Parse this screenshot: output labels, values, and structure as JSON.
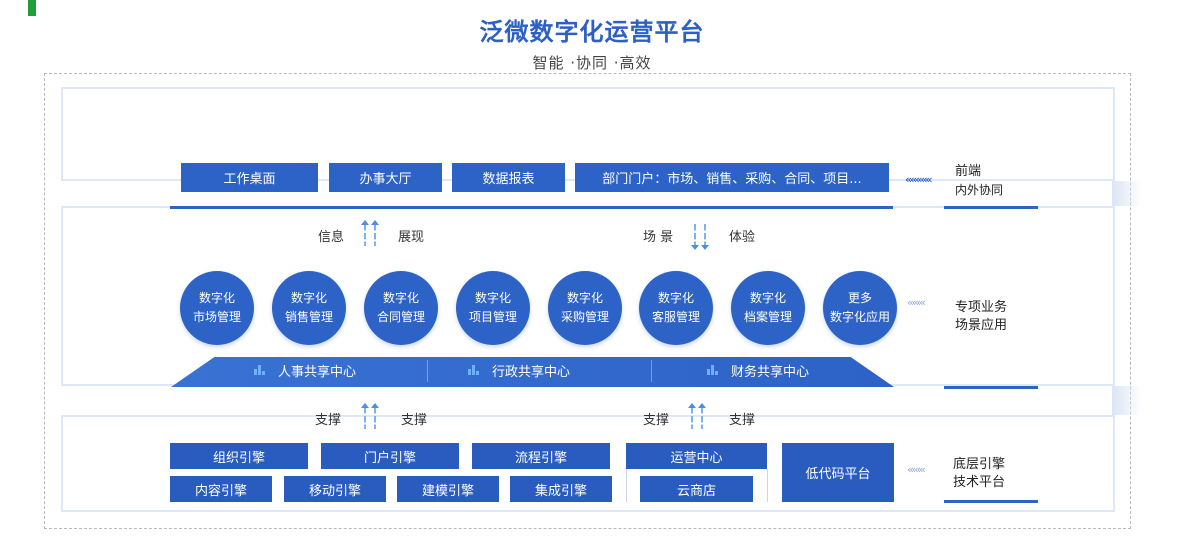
{
  "header": {
    "title": "泛微数字化运营平台",
    "subtitle": "智能 ·协同 ·高效"
  },
  "front": {
    "buttons": [
      "工作桌面",
      "办事大厅",
      "数据报表",
      "部门门户：市场、销售、采购、合同、项目..."
    ],
    "side_title": "前端",
    "side_sub": "内外协同",
    "chevrons": "«««««"
  },
  "flow_top": {
    "left_a": "信息",
    "left_b": "展现",
    "right_a": "场 景",
    "right_b": "体验"
  },
  "modules": {
    "items": [
      {
        "line1": "数字化",
        "line2": "市场管理"
      },
      {
        "line1": "数字化",
        "line2": "销售管理"
      },
      {
        "line1": "数字化",
        "line2": "合同管理"
      },
      {
        "line1": "数字化",
        "line2": "项目管理"
      },
      {
        "line1": "数字化",
        "line2": "采购管理"
      },
      {
        "line1": "数字化",
        "line2": "客服管理"
      },
      {
        "line1": "数字化",
        "line2": "档案管理"
      },
      {
        "line1": "更多",
        "line2": "数字化应用"
      }
    ],
    "side_line1": "专项业务",
    "side_line2": "场景应用",
    "chevrons": "‹‹‹‹‹‹‹"
  },
  "shared_centers": [
    "人事共享中心",
    "行政共享中心",
    "财务共享中心"
  ],
  "flow_bottom": {
    "left_a": "支撑",
    "left_b": "支撑",
    "right_a": "支撑",
    "right_b": "支撑"
  },
  "engines": {
    "row1": [
      "组织引擎",
      "门户引擎",
      "流程引擎"
    ],
    "row2": [
      "内容引擎",
      "移动引擎",
      "建模引擎",
      "集成引擎"
    ],
    "ops_center": "运营中心",
    "cloud_store": "云商店",
    "lowcode": "低代码平台",
    "side_line1": "底层引擎",
    "side_line2": "技术平台",
    "chevrons": "‹‹‹‹‹‹‹"
  },
  "colors": {
    "primary": "#2d62c6",
    "title": "#2d5fc4",
    "accent_green": "#1f9e3a"
  }
}
